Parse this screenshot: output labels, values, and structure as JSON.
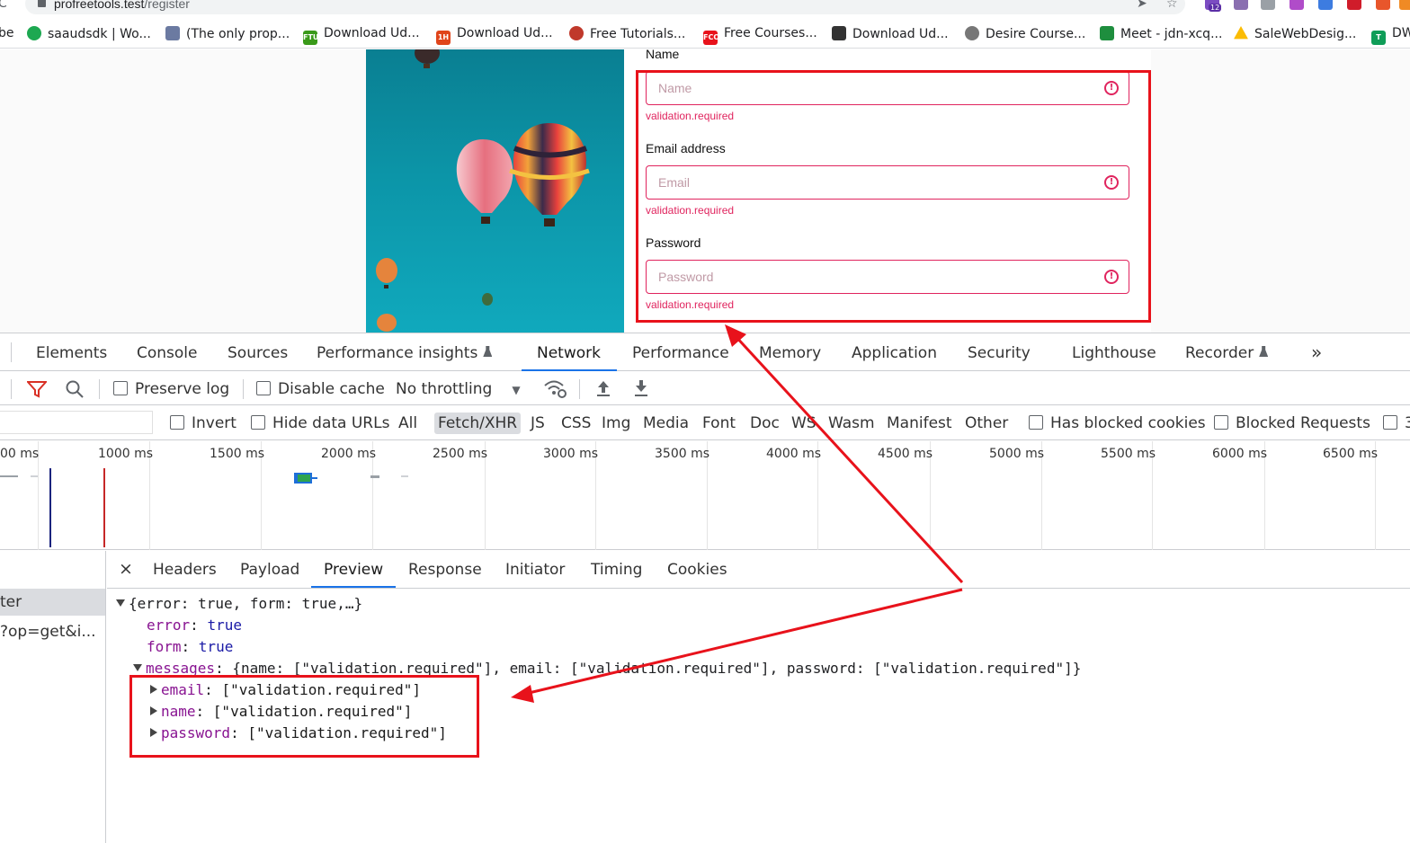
{
  "browser": {
    "url_host": "profreetools.test",
    "url_path": "/register",
    "bookmarks": [
      {
        "label": "be",
        "color": "#ffffff"
      },
      {
        "label": "saaudsdk | Wo...",
        "color": "#1da851"
      },
      {
        "label": "(The only prop...",
        "color": "#6b7aa1"
      },
      {
        "label": "Download Ud...",
        "color": "#3a9a1a"
      },
      {
        "label": "Download Ud...",
        "color": "#e0441a"
      },
      {
        "label": "Free Tutorials...",
        "color": "#c0392b"
      },
      {
        "label": "Free Courses...",
        "color": "#e8121b"
      },
      {
        "label": "Download Ud...",
        "color": "#333333"
      },
      {
        "label": "Desire Course...",
        "color": "#777777"
      },
      {
        "label": "Meet - jdn-xcq...",
        "color": "#1e8e3e"
      },
      {
        "label": "SaleWebDesig...",
        "color": "#fbbc04"
      },
      {
        "label": "DW",
        "color": "#0f9d58"
      }
    ],
    "extension_badge": "12"
  },
  "form": {
    "name_label": "Name",
    "name_placeholder": "Name",
    "email_label": "Email address",
    "email_placeholder": "Email",
    "password_label": "Password",
    "password_placeholder": "Password",
    "error_text": "validation.required",
    "error_icon": "!"
  },
  "devtools": {
    "tabs": [
      "Elements",
      "Console",
      "Sources",
      "Performance insights",
      "Network",
      "Performance",
      "Memory",
      "Application",
      "Security",
      "Lighthouse",
      "Recorder",
      "»"
    ],
    "active_tab": "Network",
    "toolbar": {
      "preserve_log": "Preserve log",
      "disable_cache": "Disable cache",
      "throttling": "No throttling"
    },
    "filters": {
      "invert": "Invert",
      "hide_data_urls": "Hide data URLs",
      "types": [
        "All",
        "Fetch/XHR",
        "JS",
        "CSS",
        "Img",
        "Media",
        "Font",
        "Doc",
        "WS",
        "Wasm",
        "Manifest",
        "Other"
      ],
      "selected_type": "Fetch/XHR",
      "has_blocked_cookies": "Has blocked cookies",
      "blocked_requests": "Blocked Requests",
      "trailing": "3"
    },
    "timeline_ticks": [
      "00 ms",
      "1000 ms",
      "1500 ms",
      "2000 ms",
      "2500 ms",
      "3000 ms",
      "3500 ms",
      "4000 ms",
      "4500 ms",
      "5000 ms",
      "5500 ms",
      "6000 ms",
      "6500 ms"
    ],
    "requests": [
      "ter",
      "?op=get&i..."
    ],
    "detail_tabs": [
      "Headers",
      "Payload",
      "Preview",
      "Response",
      "Initiator",
      "Timing",
      "Cookies"
    ],
    "active_detail_tab": "Preview",
    "close_symbol": "×",
    "preview": {
      "summary": "{error: true, form: true,…}",
      "error_key": "error",
      "error_val": "true",
      "form_key": "form",
      "form_val": "true",
      "messages_key": "messages",
      "messages_summary": "{name: [\"validation.required\"], email: [\"validation.required\"], password: [\"validation.required\"]}",
      "items": [
        {
          "key": "email",
          "val": "[\"validation.required\"]"
        },
        {
          "key": "name",
          "val": "[\"validation.required\"]"
        },
        {
          "key": "password",
          "val": "[\"validation.required\"]"
        }
      ]
    }
  },
  "colors": {
    "error": "#e0245e",
    "annotation": "#e8121b",
    "active_tab": "#1a73e8"
  }
}
